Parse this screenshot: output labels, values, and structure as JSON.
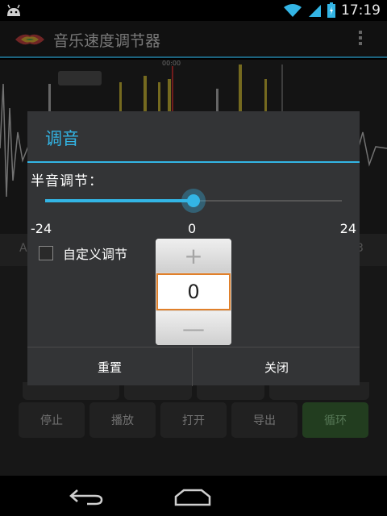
{
  "status_bar": {
    "time": "17:19",
    "icons": [
      "android-icon",
      "wifi-icon",
      "signal-icon",
      "battery-icon"
    ]
  },
  "app": {
    "title": "音乐速度调节器"
  },
  "background": {
    "timecode": "00:00",
    "hint_left": "A",
    "hint_right": "3",
    "buttons": [
      {
        "label": "停止",
        "active": false
      },
      {
        "label": "播放",
        "active": false
      },
      {
        "label": "打开",
        "active": false
      },
      {
        "label": "导出",
        "active": false
      },
      {
        "label": "循环",
        "active": true
      }
    ]
  },
  "dialog": {
    "title": "调音",
    "pitch_label": "半音调节：",
    "slider": {
      "min": -24,
      "max": 24,
      "value": 0
    },
    "ticks": {
      "min": "-24",
      "mid": "0",
      "max": "24"
    },
    "custom_label": "自定义调节",
    "custom_checked": false,
    "stepper": {
      "plus": "+",
      "value": "0",
      "minus": "—"
    },
    "reset_label": "重置",
    "close_label": "关闭"
  },
  "colors": {
    "accent": "#33b5e5",
    "active_button": "#3e6f3a",
    "stepper_focus": "#e0802b"
  }
}
